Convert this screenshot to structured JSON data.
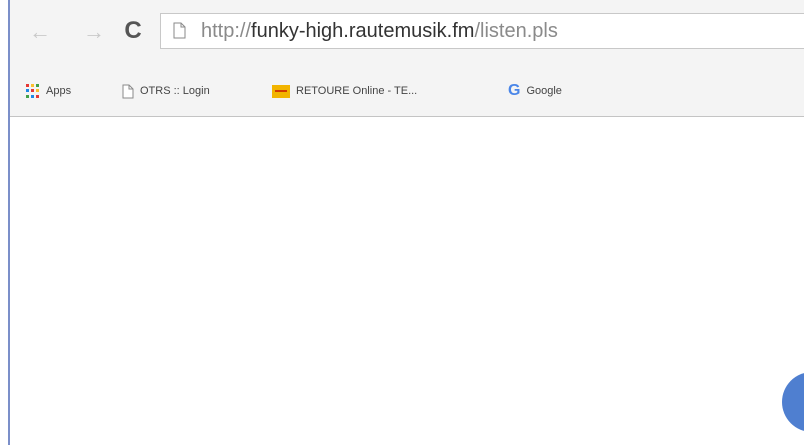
{
  "toolbar": {
    "back_icon": "arrow-left-icon",
    "forward_icon": "arrow-right-icon",
    "reload_icon": "reload-icon",
    "url_scheme": "http://",
    "url_host": "funky-high.rautemusik.fm",
    "url_path": "/listen.pls"
  },
  "bookmarks": {
    "items": [
      {
        "label": "Apps",
        "icon": "apps-grid-icon"
      },
      {
        "label": "OTRS :: Login",
        "icon": "page-icon"
      },
      {
        "label": "RETOURE Online - TE...",
        "icon": "retoure-icon"
      },
      {
        "label": "Google",
        "icon": "google-icon"
      }
    ]
  },
  "colors": {
    "toolbar_bg": "#f4f4f4",
    "window_border": "#7b8fc9",
    "fab": "#4f7fd0",
    "apps_dots": [
      "#e53935",
      "#fbc02d",
      "#43a047",
      "#1e88e5"
    ]
  }
}
